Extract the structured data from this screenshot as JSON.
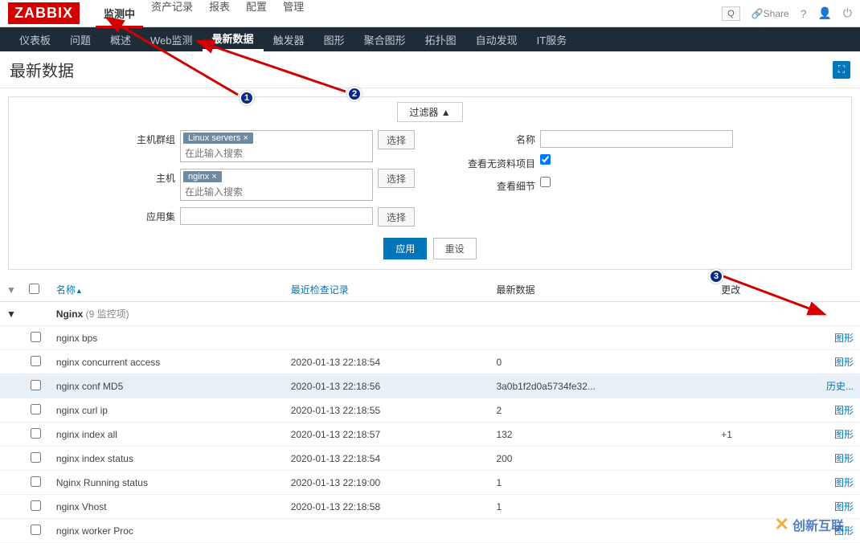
{
  "logo": "ZABBIX",
  "top_menu": [
    "监测中",
    "资产记录",
    "报表",
    "配置",
    "管理"
  ],
  "top_active_index": 0,
  "search_btn": "Q",
  "share_label": "Share",
  "sub_menu": [
    "仪表板",
    "问题",
    "概述",
    "Web监测",
    "最新数据",
    "触发器",
    "图形",
    "聚合图形",
    "拓扑图",
    "自动发现",
    "IT服务"
  ],
  "sub_active_index": 4,
  "page_title": "最新数据",
  "filter": {
    "toggle": "过滤器 ▲",
    "hostgroup_label": "主机群组",
    "hostgroup_tag": "Linux servers ×",
    "host_label": "主机",
    "host_tag": "nginx ×",
    "app_label": "应用集",
    "placeholder_search": "在此输入搜索",
    "select_btn": "选择",
    "name_label": "名称",
    "empty_label": "查看无资料项目",
    "detail_label": "查看细节",
    "empty_checked": true,
    "detail_checked": false,
    "apply_btn": "应用",
    "reset_btn": "重设"
  },
  "columns": {
    "name": "名称",
    "last_check": "最近检查记录",
    "last_data": "最新数据",
    "change": "更改"
  },
  "group_row": {
    "name": "Nginx",
    "count": "(9 监控项)"
  },
  "rows": [
    {
      "name": "nginx bps",
      "check": "",
      "data": "",
      "change": "",
      "action": "图形"
    },
    {
      "name": "nginx concurrent access",
      "check": "2020-01-13 22:18:54",
      "data": "0",
      "change": "",
      "action": "图形"
    },
    {
      "name": "nginx conf MD5",
      "check": "2020-01-13 22:18:56",
      "data": "3a0b1f2d0a5734fe32...",
      "change": "",
      "action": "历史...",
      "highlight": true
    },
    {
      "name": "nginx curl ip",
      "check": "2020-01-13 22:18:55",
      "data": "2",
      "change": "",
      "action": "图形"
    },
    {
      "name": "nginx index all",
      "check": "2020-01-13 22:18:57",
      "data": "132",
      "change": "+1",
      "action": "图形"
    },
    {
      "name": "nginx index status",
      "check": "2020-01-13 22:18:54",
      "data": "200",
      "change": "",
      "action": "图形"
    },
    {
      "name": "Nginx Running status",
      "check": "2020-01-13 22:19:00",
      "data": "1",
      "change": "",
      "action": "图形"
    },
    {
      "name": "nginx Vhost",
      "check": "2020-01-13 22:18:58",
      "data": "1",
      "change": "",
      "action": "图形"
    },
    {
      "name": "nginx worker Proc",
      "check": "",
      "data": "",
      "change": "",
      "action": "图形"
    }
  ],
  "annotations": {
    "a1": "1",
    "a2": "2",
    "a3": "3"
  },
  "watermark": "创新互联"
}
